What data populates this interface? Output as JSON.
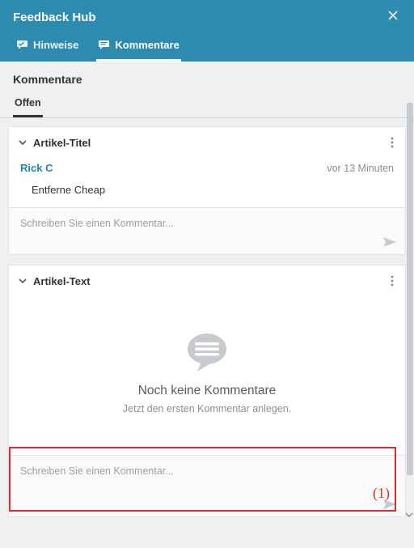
{
  "header": {
    "title": "Feedback Hub",
    "close_label": "×"
  },
  "tabs": {
    "hints": {
      "label": "Hinweise"
    },
    "comments": {
      "label": "Kommentare"
    }
  },
  "section_title": "Kommentare",
  "subtab_open": "Offen",
  "card1": {
    "title": "Artikel-Titel",
    "author": "Rick C",
    "time": "vor 13 Minuten",
    "comment": "Entferne Cheap",
    "input_placeholder": "Schreiben Sie einen Kommentar..."
  },
  "card2": {
    "title": "Artikel-Text",
    "empty_title": "Noch keine Kommentare",
    "empty_sub": "Jetzt den ersten Kommentar anlegen.",
    "input_placeholder": "Schreiben Sie einen Kommentar..."
  },
  "annotation": {
    "label": "(1)"
  }
}
